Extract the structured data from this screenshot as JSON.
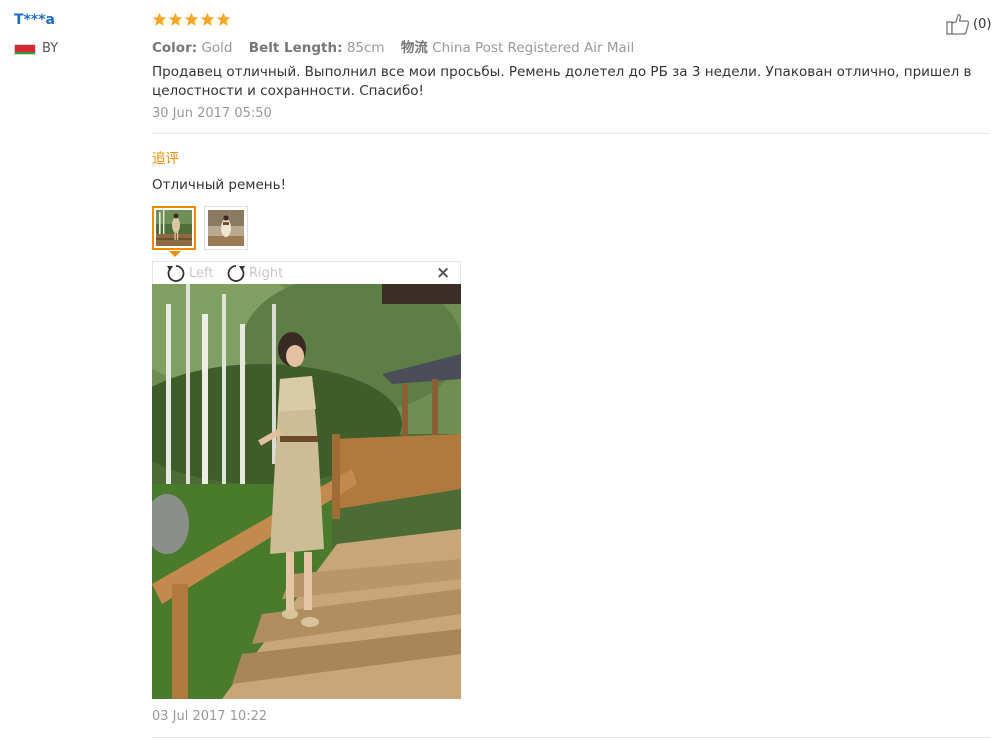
{
  "reviewer": {
    "name": "T***a",
    "country": "BY"
  },
  "rating": {
    "stars": 5,
    "max": 5
  },
  "like": {
    "count": "(0)"
  },
  "attributes": {
    "color_label": "Color:",
    "color_value": "Gold",
    "belt_label": "Belt Length:",
    "belt_value": "85cm",
    "shipping_label": "物流",
    "shipping_value": "China Post Registered Air Mail"
  },
  "review": {
    "text": "Продавец отличный. Выполнил все мои просьбы. Ремень долетел до РБ за 3 недели. Упакован отлично, пришел в целостности и сохранности. Спасибо!",
    "date": "30 Jun 2017 05:50"
  },
  "followup": {
    "label": "追评",
    "text": "Отличный ремень!",
    "date": "03 Jul 2017 10:22"
  },
  "viewer": {
    "rotate_left": "Left",
    "rotate_right": "Right",
    "close": "×"
  },
  "colors": {
    "username": "#1e6cc7",
    "accent": "#f28b00",
    "star": "#f5a623",
    "muted": "#999999"
  }
}
